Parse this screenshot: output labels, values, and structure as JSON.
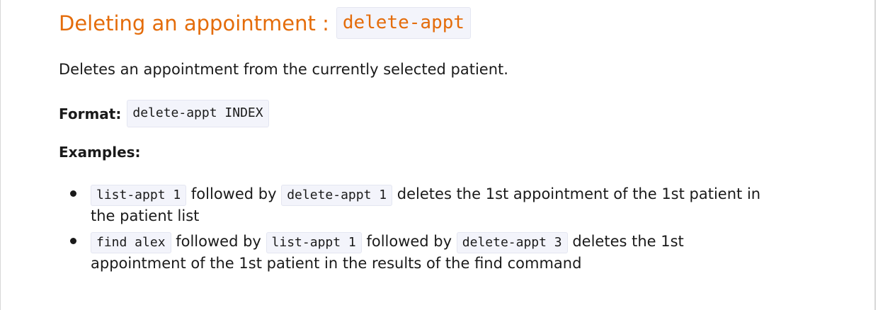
{
  "heading": {
    "text": "Deleting an appointment :",
    "code": "delete-appt"
  },
  "description": "Deletes an appointment from the currently selected patient.",
  "format": {
    "label": "Format:",
    "code": "delete-appt INDEX"
  },
  "examples": {
    "title": "Examples:",
    "items": [
      {
        "code1": "list-appt 1",
        "text1": "followed by",
        "code2": "delete-appt 1",
        "text2": "deletes the 1st appointment of the 1st patient in",
        "text3": "the patient list"
      },
      {
        "code1": "find alex",
        "text1": "followed by",
        "code2": "list-appt 1",
        "text2": "followed by",
        "code3": "delete-appt 3",
        "text3": "deletes the 1st",
        "text4": "appointment of the 1st patient in the results of the find command"
      }
    ]
  }
}
